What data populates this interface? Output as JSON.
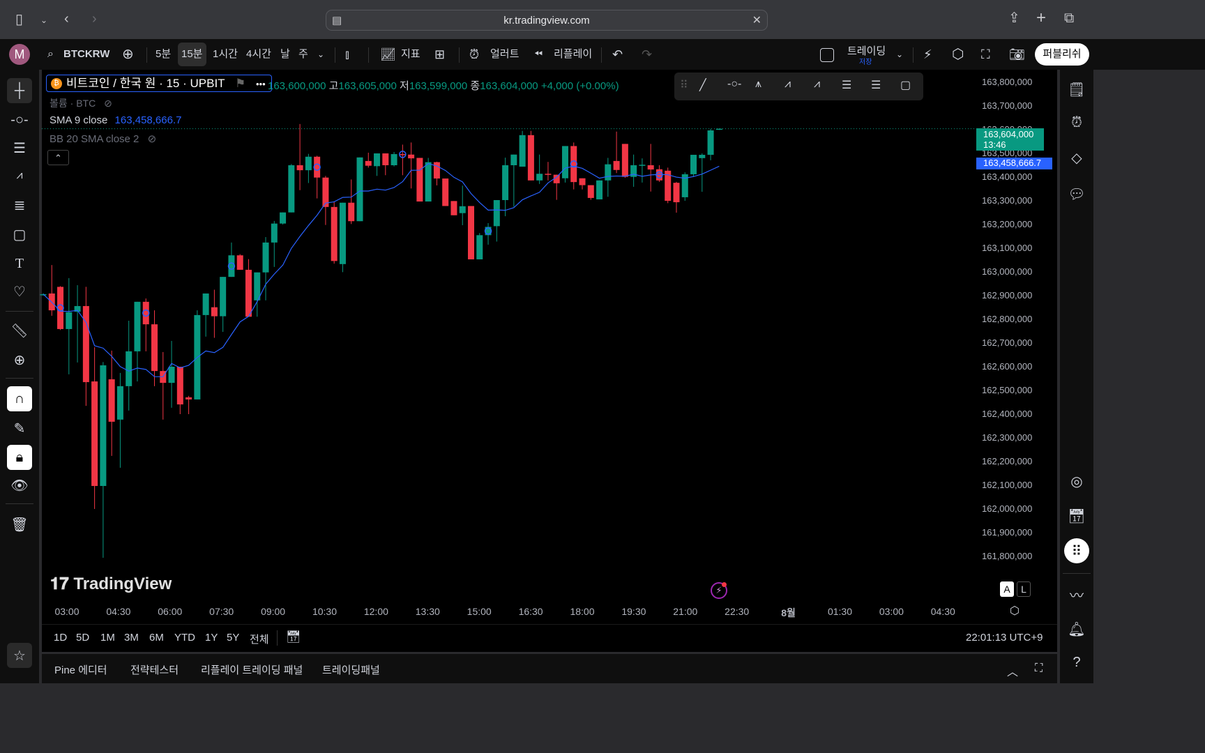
{
  "browser": {
    "url": "kr.tradingview.com"
  },
  "toolbar": {
    "avatar": "M",
    "symbol": "BTCKRW",
    "intervals": [
      "5분",
      "15분",
      "1시간",
      "4시간",
      "날",
      "주"
    ],
    "selected_interval": "15분",
    "indicators": "지표",
    "alert": "얼러트",
    "replay": "리플레이",
    "trading": "트레이딩",
    "save": "저장",
    "publish": "퍼블리쉬"
  },
  "legend": {
    "title": "비트코인 / 한국 원 · 15 · UPBIT",
    "open_label": "",
    "open": "163,600,000",
    "high_label": "고",
    "high": "163,605,000",
    "low_label": "저",
    "low": "163,599,000",
    "close_label": "종",
    "close": "163,604,000",
    "change": "+4,000 (+0.00%)",
    "volume": "볼륨 · BTC",
    "sma_label": "SMA 9 close",
    "sma_value": "163,458,666.7",
    "bb_label": "BB 20 SMA close 2"
  },
  "price_axis": {
    "labels": [
      "163,800,000",
      "163,700,000",
      "163,600,000",
      "163,500,000",
      "163,400,000",
      "163,300,000",
      "163,200,000",
      "163,100,000",
      "163,000,000",
      "162,900,000",
      "162,800,000",
      "162,700,000",
      "162,600,000",
      "162,500,000",
      "162,400,000",
      "162,300,000",
      "162,200,000",
      "162,100,000",
      "162,000,000",
      "161,900,000",
      "161,800,000"
    ],
    "last_price_tag": "163,604,000",
    "countdown": "13:46",
    "sma_tag": "163,458,666.7"
  },
  "time_axis": {
    "labels": [
      "03:00",
      "04:30",
      "06:00",
      "07:30",
      "09:00",
      "10:30",
      "12:00",
      "13:30",
      "15:00",
      "16:30",
      "18:00",
      "19:30",
      "21:00",
      "22:30",
      "8월",
      "01:30",
      "03:00",
      "04:30"
    ]
  },
  "range_bar": {
    "ranges": [
      "1D",
      "5D",
      "1M",
      "3M",
      "6M",
      "YTD",
      "1Y",
      "5Y",
      "전체"
    ],
    "clock": "22:01:13 UTC+9"
  },
  "scale_buttons": {
    "auto": "A",
    "log": "L"
  },
  "bottom_tabs": [
    "Pine 에디터",
    "전략테스터",
    "리플레이 트레이딩 패널",
    "트레이딩패널"
  ],
  "watermark": "TradingView",
  "colors": {
    "up": "#089981",
    "down": "#f23645",
    "sma": "#2962ff",
    "bg": "#000000"
  },
  "chart_data": {
    "type": "candlestick",
    "symbol": "BTCKRW",
    "interval": "15m",
    "unit": "thousand KRW",
    "first_bar_time": "02:15",
    "last_bar_time": "22:00",
    "ylim": [
      161800,
      163800
    ],
    "sma_period": 9,
    "marker_every": 10,
    "marker_offset": 2,
    "ohlc": [
      [
        162905,
        162910,
        162900,
        162906
      ],
      [
        162909,
        163029,
        162815,
        162838
      ],
      [
        162937,
        162940,
        162755,
        162759
      ],
      [
        162759,
        162974,
        162568,
        162830
      ],
      [
        162832,
        162944,
        162618,
        162856
      ],
      [
        162856,
        162937,
        162435,
        162535
      ],
      [
        162538,
        162682,
        162000,
        162097
      ],
      [
        162097,
        162620,
        161794,
        162606
      ],
      [
        162547,
        162668,
        162224,
        162368
      ],
      [
        162377,
        162574,
        162174,
        162518
      ],
      [
        162518,
        162794,
        162415,
        162665
      ],
      [
        162665,
        162874,
        162538,
        162874
      ],
      [
        162874,
        162888,
        162665,
        162779
      ],
      [
        162779,
        162838,
        162518,
        162582
      ],
      [
        162582,
        162662,
        162377,
        162532
      ],
      [
        162532,
        162709,
        162427,
        162600
      ],
      [
        162600,
        162600,
        162400,
        162441
      ],
      [
        162471,
        162477,
        162400,
        162462
      ],
      [
        162462,
        162838,
        162462,
        162818
      ],
      [
        162818,
        162909,
        162727,
        162909
      ],
      [
        162851,
        162925,
        162722,
        162813
      ],
      [
        162813,
        162979,
        162747,
        162979
      ],
      [
        162979,
        163124,
        162979,
        163070
      ],
      [
        163070,
        163075,
        163009,
        163009
      ],
      [
        163009,
        163054,
        162811,
        162811
      ],
      [
        162880,
        162998,
        162811,
        162998
      ],
      [
        162998,
        163147,
        162880,
        163124
      ],
      [
        163124,
        163215,
        163021,
        163204
      ],
      [
        163204,
        163251,
        163200,
        163251
      ],
      [
        163251,
        163455,
        163251,
        163450
      ],
      [
        163450,
        163624,
        163345,
        163429
      ],
      [
        163429,
        163498,
        163375,
        163486
      ],
      [
        163486,
        163490,
        163310,
        163398
      ],
      [
        163398,
        163405,
        163198,
        163274
      ],
      [
        163274,
        163297,
        163035,
        163046
      ],
      [
        163033,
        163292,
        162999,
        163292
      ],
      [
        163292,
        163390,
        163202,
        163214
      ],
      [
        163214,
        163483,
        163214,
        163483
      ],
      [
        163468,
        163503,
        163440,
        163448
      ],
      [
        163446,
        163500,
        163405,
        163500
      ],
      [
        163500,
        163500,
        163408,
        163450
      ],
      [
        163450,
        163506,
        163445,
        163497
      ],
      [
        163497,
        163537,
        163408,
        163495
      ],
      [
        163495,
        163546,
        163352,
        163479
      ],
      [
        163481,
        163481,
        163297,
        163297
      ],
      [
        163297,
        163481,
        163297,
        163463
      ],
      [
        163463,
        163465,
        163365,
        163394
      ],
      [
        163394,
        163394,
        163278,
        163278
      ],
      [
        163299,
        163299,
        163239,
        163239
      ],
      [
        163248,
        163364,
        163197,
        163277
      ],
      [
        163278,
        163278,
        163053,
        163053
      ],
      [
        163053,
        163164,
        163053,
        163155
      ],
      [
        163155,
        163206,
        163115,
        163190
      ],
      [
        163193,
        163303,
        163128,
        163303
      ],
      [
        163303,
        163482,
        163235,
        163450
      ],
      [
        163450,
        163495,
        163275,
        163495
      ],
      [
        163444,
        163595,
        163444,
        163577
      ],
      [
        163577,
        163595,
        163386,
        163386
      ],
      [
        163386,
        163495,
        163371,
        163414
      ],
      [
        163414,
        163464,
        163386,
        163410
      ],
      [
        163410,
        163410,
        163304,
        163374
      ],
      [
        163395,
        163531,
        163377,
        163531
      ],
      [
        163531,
        163546,
        163348,
        163379
      ],
      [
        163395,
        163395,
        163348,
        163366
      ],
      [
        163366,
        163366,
        163304,
        163312
      ],
      [
        163306,
        163386,
        163306,
        163386
      ],
      [
        163386,
        163481,
        163317,
        163454
      ],
      [
        163468,
        163592,
        163417,
        163430
      ],
      [
        163540,
        163540,
        163397,
        163401
      ],
      [
        163401,
        163495,
        163359,
        163450
      ],
      [
        163450,
        163479,
        163377,
        163452
      ],
      [
        163450,
        163540,
        163339,
        163432
      ],
      [
        163433,
        163450,
        163380,
        163386
      ],
      [
        163427,
        163440,
        163290,
        163300
      ],
      [
        163376,
        163380,
        163250,
        163294
      ],
      [
        163315,
        163420,
        163300,
        163412
      ],
      [
        163412,
        163494,
        163400,
        163494
      ],
      [
        163480,
        163500,
        163338,
        163494
      ],
      [
        163494,
        163604,
        163471,
        163597
      ],
      [
        163600,
        163605,
        163599,
        163604
      ]
    ]
  }
}
